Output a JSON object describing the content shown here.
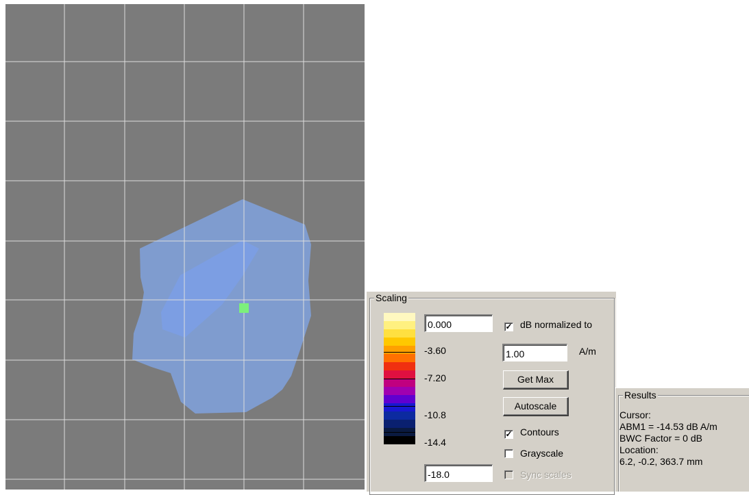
{
  "plot": {
    "background": "#7b7b7b",
    "grid_color": "#dedede",
    "outer_region_color": "#7f9ccf",
    "inner_region_color": "#7c9ee3",
    "marker_color": "#7cf07c"
  },
  "scaling": {
    "title": "Scaling",
    "max_value": "0.000",
    "min_value": "-18.0",
    "tick_labels": [
      "-3.60",
      "-7.20",
      "-10.8",
      "-14.4"
    ],
    "colorbar": [
      "#fff8c0",
      "#fff080",
      "#ffe040",
      "#ffc800",
      "#ffa000",
      "#ff7000",
      "#f03010",
      "#e01040",
      "#c00080",
      "#a000b0",
      "#6000d0",
      "#1818d0",
      "#0c2aa0",
      "#0a2070",
      "#0a1a40",
      "#000000"
    ],
    "db_normalized": {
      "label": "dB normalized to",
      "checked": true
    },
    "normalize_value": "1.00",
    "unit": "A/m",
    "get_max_label": "Get Max",
    "autoscale_label": "Autoscale",
    "contours": {
      "label": "Contours",
      "checked": true
    },
    "grayscale": {
      "label": "Grayscale",
      "checked": false
    },
    "sync_scales": {
      "label": "Sync scales",
      "checked": false,
      "disabled": true
    }
  },
  "results": {
    "title": "Results",
    "lines": [
      "Cursor:",
      "ABM1 = -14.53 dB A/m",
      "BWC Factor = 0 dB",
      "Location:",
      "6.2, -0.2, 363.7 mm"
    ]
  }
}
